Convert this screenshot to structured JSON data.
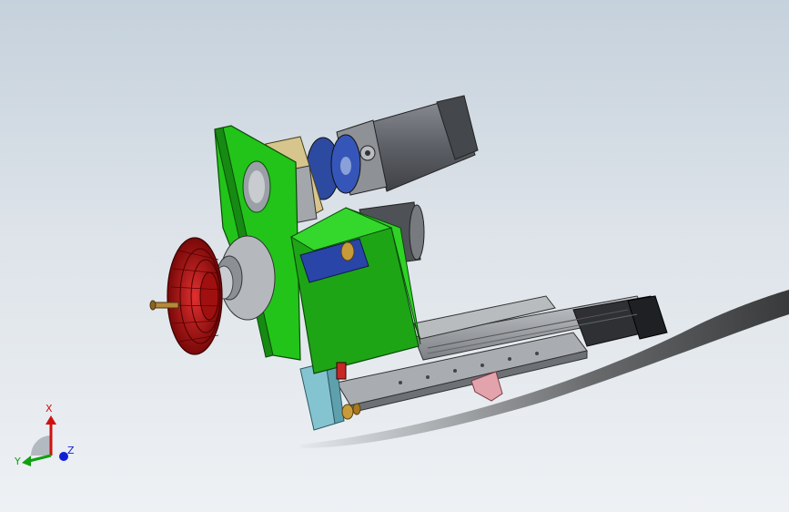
{
  "view": {
    "background_top": "#c5d1dc",
    "background_bottom": "#eef1f4",
    "part_colors": {
      "plate": "#22c41a",
      "pulley": "#c81010",
      "coupling": "#2c4aa0",
      "motor": "#6b6e74",
      "rail": "#9ea2a6",
      "mount_block": "#7fc0cc",
      "bracket": "#e0a0a8"
    }
  },
  "triad": {
    "x_label": "X",
    "y_label": "Y",
    "z_label": "Z",
    "x_color": "#d01010",
    "y_color": "#10a010",
    "z_color": "#1020d0"
  }
}
